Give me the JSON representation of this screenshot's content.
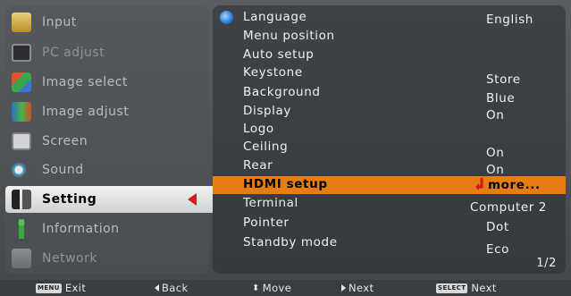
{
  "left_menu": {
    "items": [
      {
        "label": "Input",
        "icon": "input-icon",
        "color": "#d9b24a",
        "dim": false,
        "active": false
      },
      {
        "label": "PC adjust",
        "icon": "pc-adjust-icon",
        "color": "#6a6d72",
        "dim": true,
        "active": false
      },
      {
        "label": "Image select",
        "icon": "image-select-icon",
        "color": "#c43a2a",
        "dim": false,
        "active": false
      },
      {
        "label": "Image adjust",
        "icon": "image-adjust-icon",
        "color": "#2a7ad0",
        "dim": false,
        "active": false
      },
      {
        "label": "Screen",
        "icon": "screen-icon",
        "color": "#8d9196",
        "dim": false,
        "active": false
      },
      {
        "label": "Sound",
        "icon": "sound-icon",
        "color": "#b8bcc2",
        "dim": false,
        "active": false
      },
      {
        "label": "Setting",
        "icon": "setting-icon",
        "color": "#222222",
        "dim": false,
        "active": true
      },
      {
        "label": "Information",
        "icon": "information-icon",
        "color": "#3ba83a",
        "dim": false,
        "active": false
      },
      {
        "label": "Network",
        "icon": "network-icon",
        "color": "#a7aaae",
        "dim": true,
        "active": false
      }
    ]
  },
  "setting_panel": {
    "rows": [
      {
        "name": "Language",
        "value": "English",
        "icon": "globe-icon"
      },
      {
        "name": "Menu position",
        "value": ""
      },
      {
        "name": "Auto setup",
        "value": ""
      },
      {
        "name": "Keystone",
        "value": "Store"
      },
      {
        "name": "Background",
        "value": "Blue"
      },
      {
        "name": "Display",
        "value": "On"
      },
      {
        "name": "Logo",
        "value": ""
      },
      {
        "name": "Ceiling",
        "value": "On"
      },
      {
        "name": "Rear",
        "value": "On"
      },
      {
        "name": "HDMI setup",
        "value": "more...",
        "selected": true
      },
      {
        "name": "Terminal",
        "value": "Computer 2"
      },
      {
        "name": "Pointer",
        "value": "Dot"
      },
      {
        "name": "Standby mode",
        "value": "Eco"
      }
    ],
    "page_indicator": "1/2"
  },
  "bottom_bar": {
    "exit_key": "MENU",
    "exit_label": "Exit",
    "back_label": "Back",
    "move_label": "Move",
    "next_label": "Next",
    "select_key": "SELECT",
    "select_label": "Next"
  },
  "colors": {
    "highlight": "#e57d12",
    "accent_red": "#e0141e"
  }
}
